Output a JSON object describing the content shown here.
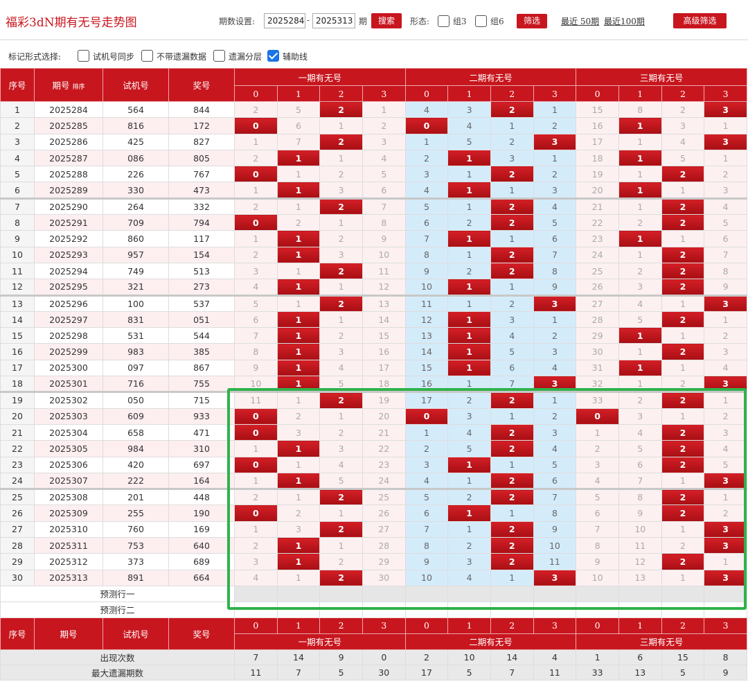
{
  "header": {
    "title": "福彩3dN期有无号走势图",
    "period_label": "期数设置:",
    "period_start": "2025284",
    "period_end": "2025313",
    "period_unit": "期",
    "search_label": "搜索",
    "form_label": "形态:",
    "form_opt1": "组3",
    "form_opt2": "组6",
    "filter_label": "筛选",
    "recent50": "最近 50期",
    "recent100": "最近100期",
    "advanced_label": "高级筛选"
  },
  "markbar": {
    "label": "标记形式选择:",
    "opt1": "试机号同步",
    "opt2": "不带遗漏数据",
    "opt3": "遗漏分层",
    "opt4": "辅助线",
    "opt4_checked": true
  },
  "table": {
    "col_index": "序号",
    "col_issue": "期号",
    "sort_label": "排序",
    "col_shiji": "试机号",
    "col_jiang": "奖号",
    "groups": [
      "一期有无号",
      "二期有无号",
      "三期有无号"
    ],
    "digits": [
      "0",
      "1",
      "2",
      "3"
    ],
    "rows": [
      {
        "i": "1",
        "issue": "2025284",
        "shi": "564",
        "jiang": "844",
        "v": [
          "2",
          "5",
          "2",
          "1",
          "4",
          "3",
          "2",
          "1",
          "15",
          "8",
          "2",
          "3"
        ],
        "h": [
          2,
          6,
          11
        ]
      },
      {
        "i": "2",
        "issue": "2025285",
        "shi": "816",
        "jiang": "172",
        "v": [
          "0",
          "6",
          "1",
          "2",
          "0",
          "4",
          "1",
          "2",
          "16",
          "1",
          "3",
          "1"
        ],
        "h": [
          0,
          4,
          9
        ]
      },
      {
        "i": "3",
        "issue": "2025286",
        "shi": "425",
        "jiang": "827",
        "v": [
          "1",
          "7",
          "2",
          "3",
          "1",
          "5",
          "2",
          "3",
          "17",
          "1",
          "4",
          "3"
        ],
        "h": [
          2,
          7,
          11
        ]
      },
      {
        "i": "4",
        "issue": "2025287",
        "shi": "086",
        "jiang": "805",
        "v": [
          "2",
          "1",
          "1",
          "4",
          "2",
          "1",
          "3",
          "1",
          "18",
          "1",
          "5",
          "1"
        ],
        "h": [
          1,
          5,
          9
        ]
      },
      {
        "i": "5",
        "issue": "2025288",
        "shi": "226",
        "jiang": "767",
        "v": [
          "0",
          "1",
          "2",
          "5",
          "3",
          "1",
          "2",
          "2",
          "19",
          "1",
          "2",
          "2"
        ],
        "h": [
          0,
          6,
          10
        ]
      },
      {
        "i": "6",
        "issue": "2025289",
        "shi": "330",
        "jiang": "473",
        "v": [
          "1",
          "1",
          "3",
          "6",
          "4",
          "1",
          "1",
          "3",
          "20",
          "1",
          "1",
          "3"
        ],
        "h": [
          1,
          5,
          9
        ]
      },
      {
        "i": "7",
        "issue": "2025290",
        "shi": "264",
        "jiang": "332",
        "v": [
          "2",
          "1",
          "2",
          "7",
          "5",
          "1",
          "2",
          "4",
          "21",
          "1",
          "2",
          "4"
        ],
        "h": [
          2,
          6,
          10
        ]
      },
      {
        "i": "8",
        "issue": "2025291",
        "shi": "709",
        "jiang": "794",
        "v": [
          "0",
          "2",
          "1",
          "8",
          "6",
          "2",
          "2",
          "5",
          "22",
          "2",
          "2",
          "5"
        ],
        "h": [
          0,
          6,
          10
        ]
      },
      {
        "i": "9",
        "issue": "2025292",
        "shi": "860",
        "jiang": "117",
        "v": [
          "1",
          "1",
          "2",
          "9",
          "7",
          "1",
          "1",
          "6",
          "23",
          "1",
          "1",
          "6"
        ],
        "h": [
          1,
          5,
          9
        ]
      },
      {
        "i": "10",
        "issue": "2025293",
        "shi": "957",
        "jiang": "154",
        "v": [
          "2",
          "1",
          "3",
          "10",
          "8",
          "1",
          "2",
          "7",
          "24",
          "1",
          "2",
          "7"
        ],
        "h": [
          1,
          6,
          10
        ]
      },
      {
        "i": "11",
        "issue": "2025294",
        "shi": "749",
        "jiang": "513",
        "v": [
          "3",
          "1",
          "2",
          "11",
          "9",
          "2",
          "2",
          "8",
          "25",
          "2",
          "2",
          "8"
        ],
        "h": [
          2,
          6,
          10
        ]
      },
      {
        "i": "12",
        "issue": "2025295",
        "shi": "321",
        "jiang": "273",
        "v": [
          "4",
          "1",
          "1",
          "12",
          "10",
          "1",
          "1",
          "9",
          "26",
          "3",
          "2",
          "9"
        ],
        "h": [
          1,
          5,
          10
        ]
      },
      {
        "i": "13",
        "issue": "2025296",
        "shi": "100",
        "jiang": "537",
        "v": [
          "5",
          "1",
          "2",
          "13",
          "11",
          "1",
          "2",
          "3",
          "27",
          "4",
          "1",
          "3"
        ],
        "h": [
          2,
          7,
          11
        ]
      },
      {
        "i": "14",
        "issue": "2025297",
        "shi": "831",
        "jiang": "051",
        "v": [
          "6",
          "1",
          "1",
          "14",
          "12",
          "1",
          "3",
          "1",
          "28",
          "5",
          "2",
          "1"
        ],
        "h": [
          1,
          5,
          10
        ]
      },
      {
        "i": "15",
        "issue": "2025298",
        "shi": "531",
        "jiang": "544",
        "v": [
          "7",
          "1",
          "2",
          "15",
          "13",
          "1",
          "4",
          "2",
          "29",
          "1",
          "1",
          "2"
        ],
        "h": [
          1,
          5,
          9
        ]
      },
      {
        "i": "16",
        "issue": "2025299",
        "shi": "983",
        "jiang": "385",
        "v": [
          "8",
          "1",
          "3",
          "16",
          "14",
          "1",
          "5",
          "3",
          "30",
          "1",
          "2",
          "3"
        ],
        "h": [
          1,
          5,
          10
        ]
      },
      {
        "i": "17",
        "issue": "2025300",
        "shi": "097",
        "jiang": "867",
        "v": [
          "9",
          "1",
          "4",
          "17",
          "15",
          "1",
          "6",
          "4",
          "31",
          "1",
          "1",
          "4"
        ],
        "h": [
          1,
          5,
          9
        ]
      },
      {
        "i": "18",
        "issue": "2025301",
        "shi": "716",
        "jiang": "755",
        "v": [
          "10",
          "1",
          "5",
          "18",
          "16",
          "1",
          "7",
          "3",
          "32",
          "1",
          "2",
          "3"
        ],
        "h": [
          1,
          7,
          11
        ]
      },
      {
        "i": "19",
        "issue": "2025302",
        "shi": "050",
        "jiang": "715",
        "v": [
          "11",
          "1",
          "2",
          "19",
          "17",
          "2",
          "2",
          "1",
          "33",
          "2",
          "2",
          "1"
        ],
        "h": [
          2,
          6,
          10
        ]
      },
      {
        "i": "20",
        "issue": "2025303",
        "shi": "609",
        "jiang": "933",
        "v": [
          "0",
          "2",
          "1",
          "20",
          "0",
          "3",
          "1",
          "2",
          "0",
          "3",
          "1",
          "2"
        ],
        "h": [
          0,
          4,
          8
        ]
      },
      {
        "i": "21",
        "issue": "2025304",
        "shi": "658",
        "jiang": "471",
        "v": [
          "0",
          "3",
          "2",
          "21",
          "1",
          "4",
          "2",
          "3",
          "1",
          "4",
          "2",
          "3"
        ],
        "h": [
          0,
          6,
          10
        ]
      },
      {
        "i": "22",
        "issue": "2025305",
        "shi": "984",
        "jiang": "310",
        "v": [
          "1",
          "1",
          "3",
          "22",
          "2",
          "5",
          "2",
          "4",
          "2",
          "5",
          "2",
          "4"
        ],
        "h": [
          1,
          6,
          10
        ]
      },
      {
        "i": "23",
        "issue": "2025306",
        "shi": "420",
        "jiang": "697",
        "v": [
          "0",
          "1",
          "4",
          "23",
          "3",
          "1",
          "1",
          "5",
          "3",
          "6",
          "2",
          "5"
        ],
        "h": [
          0,
          5,
          10
        ]
      },
      {
        "i": "24",
        "issue": "2025307",
        "shi": "222",
        "jiang": "164",
        "v": [
          "1",
          "1",
          "5",
          "24",
          "4",
          "1",
          "2",
          "6",
          "4",
          "7",
          "1",
          "3"
        ],
        "h": [
          1,
          6,
          11
        ]
      },
      {
        "i": "25",
        "issue": "2025308",
        "shi": "201",
        "jiang": "448",
        "v": [
          "2",
          "1",
          "2",
          "25",
          "5",
          "2",
          "2",
          "7",
          "5",
          "8",
          "2",
          "1"
        ],
        "h": [
          2,
          6,
          10
        ]
      },
      {
        "i": "26",
        "issue": "2025309",
        "shi": "255",
        "jiang": "190",
        "v": [
          "0",
          "2",
          "1",
          "26",
          "6",
          "1",
          "1",
          "8",
          "6",
          "9",
          "2",
          "2"
        ],
        "h": [
          0,
          5,
          10
        ]
      },
      {
        "i": "27",
        "issue": "2025310",
        "shi": "760",
        "jiang": "169",
        "v": [
          "1",
          "3",
          "2",
          "27",
          "7",
          "1",
          "2",
          "9",
          "7",
          "10",
          "1",
          "3"
        ],
        "h": [
          2,
          6,
          11
        ]
      },
      {
        "i": "28",
        "issue": "2025311",
        "shi": "753",
        "jiang": "640",
        "v": [
          "2",
          "1",
          "1",
          "28",
          "8",
          "2",
          "2",
          "10",
          "8",
          "11",
          "2",
          "3"
        ],
        "h": [
          1,
          6,
          11
        ]
      },
      {
        "i": "29",
        "issue": "2025312",
        "shi": "373",
        "jiang": "689",
        "v": [
          "3",
          "1",
          "2",
          "29",
          "9",
          "3",
          "2",
          "11",
          "9",
          "12",
          "2",
          "1"
        ],
        "h": [
          1,
          6,
          10
        ]
      },
      {
        "i": "30",
        "issue": "2025313",
        "shi": "891",
        "jiang": "664",
        "v": [
          "4",
          "1",
          "2",
          "30",
          "10",
          "4",
          "1",
          "3",
          "10",
          "13",
          "1",
          "3"
        ],
        "h": [
          2,
          7,
          11
        ]
      }
    ],
    "predict1": "预测行一",
    "predict2": "预测行二",
    "stat_count_label": "出现次数",
    "stat_count": [
      "7",
      "14",
      "9",
      "0",
      "2",
      "10",
      "14",
      "4",
      "1",
      "6",
      "15",
      "8"
    ],
    "stat_maxmiss_label": "最大遗漏期数",
    "stat_maxmiss": [
      "11",
      "7",
      "5",
      "30",
      "17",
      "5",
      "7",
      "11",
      "33",
      "13",
      "5",
      "9"
    ]
  },
  "colors": {
    "accent": "#c8161e",
    "highlight": "#2fb24c",
    "mid_group_bg": "#d4ebfa"
  }
}
